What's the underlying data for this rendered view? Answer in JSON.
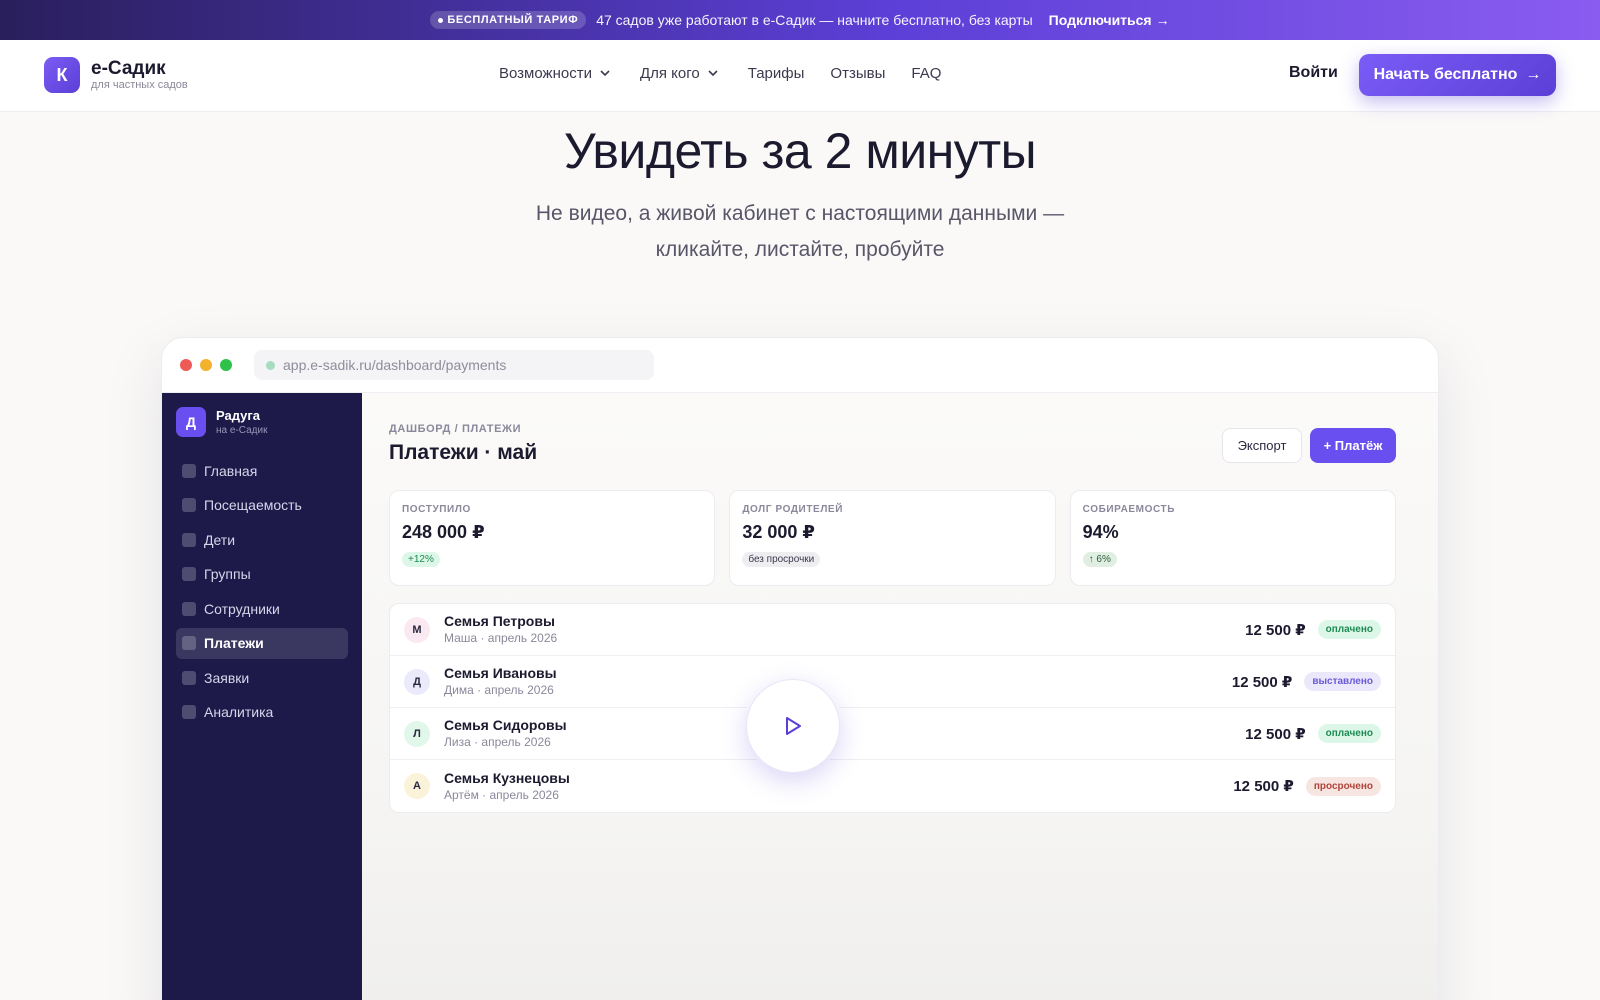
{
  "promo": {
    "badge": "БЕСПЛАТНЫЙ ТАРИФ",
    "text": "47 садов уже работают в е-Садик — начните бесплатно, без карты",
    "link": "Подключиться"
  },
  "header": {
    "logo_letter": "К",
    "logo_name": "е-Садик",
    "logo_sub": "для частных садов",
    "nav": [
      "Возможности",
      "Для кого",
      "Тарифы",
      "Отзывы",
      "FAQ"
    ],
    "login": "Войти",
    "cta": "Начать бесплатно"
  },
  "hero": {
    "title": "Увидеть за 2 минуты",
    "subtitle": "Не видео, а живой кабинет с настоящими данными — кликайте, листайте, пробуйте"
  },
  "demo": {
    "url": "app.e-sadik.ru/dashboard/payments",
    "org": {
      "letter": "Д",
      "name": "Радуга",
      "sub": "на е-Садик"
    },
    "menu": [
      "Главная",
      "Посещаемость",
      "Дети",
      "Группы",
      "Сотрудники",
      "Платежи",
      "Заявки",
      "Аналитика"
    ],
    "active_menu": "Платежи",
    "breadcrumb": "ДАШБОРД / ПЛАТЕЖИ",
    "title": "Платежи · май",
    "export": "Экспорт",
    "add_payment": "+ Платёж",
    "kpis": [
      {
        "label": "ПОСТУПИЛО",
        "value": "248 000 ₽",
        "badge": "+12%"
      },
      {
        "label": "ДОЛГ РОДИТЕЛЕЙ",
        "value": "32 000 ₽",
        "badge": "без просрочки"
      },
      {
        "label": "СОБИРАЕМОСТЬ",
        "value": "94%",
        "badge": "↑ 6%"
      }
    ],
    "payments": [
      {
        "initial": "М",
        "family": "Семья Петровы",
        "detail": "Маша · апрель 2026",
        "amount": "12 500 ₽",
        "status": "оплачено"
      },
      {
        "initial": "Д",
        "family": "Семья Ивановы",
        "detail": "Дима · апрель 2026",
        "amount": "12 500 ₽",
        "status": "выставлено"
      },
      {
        "initial": "Л",
        "family": "Семья Сидоровы",
        "detail": "Лиза · апрель 2026",
        "amount": "12 500 ₽",
        "status": "оплачено"
      },
      {
        "initial": "А",
        "family": "Семья Кузнецовы",
        "detail": "Артём · апрель 2026",
        "amount": "12 500 ₽",
        "status": "просрочено"
      }
    ]
  },
  "colors": {
    "accent": "#6a4ff0",
    "sidebar": "#1d1a4a",
    "paid": "#1f8a55",
    "issued": "#6a5bd6",
    "overdue": "#b0443a"
  }
}
